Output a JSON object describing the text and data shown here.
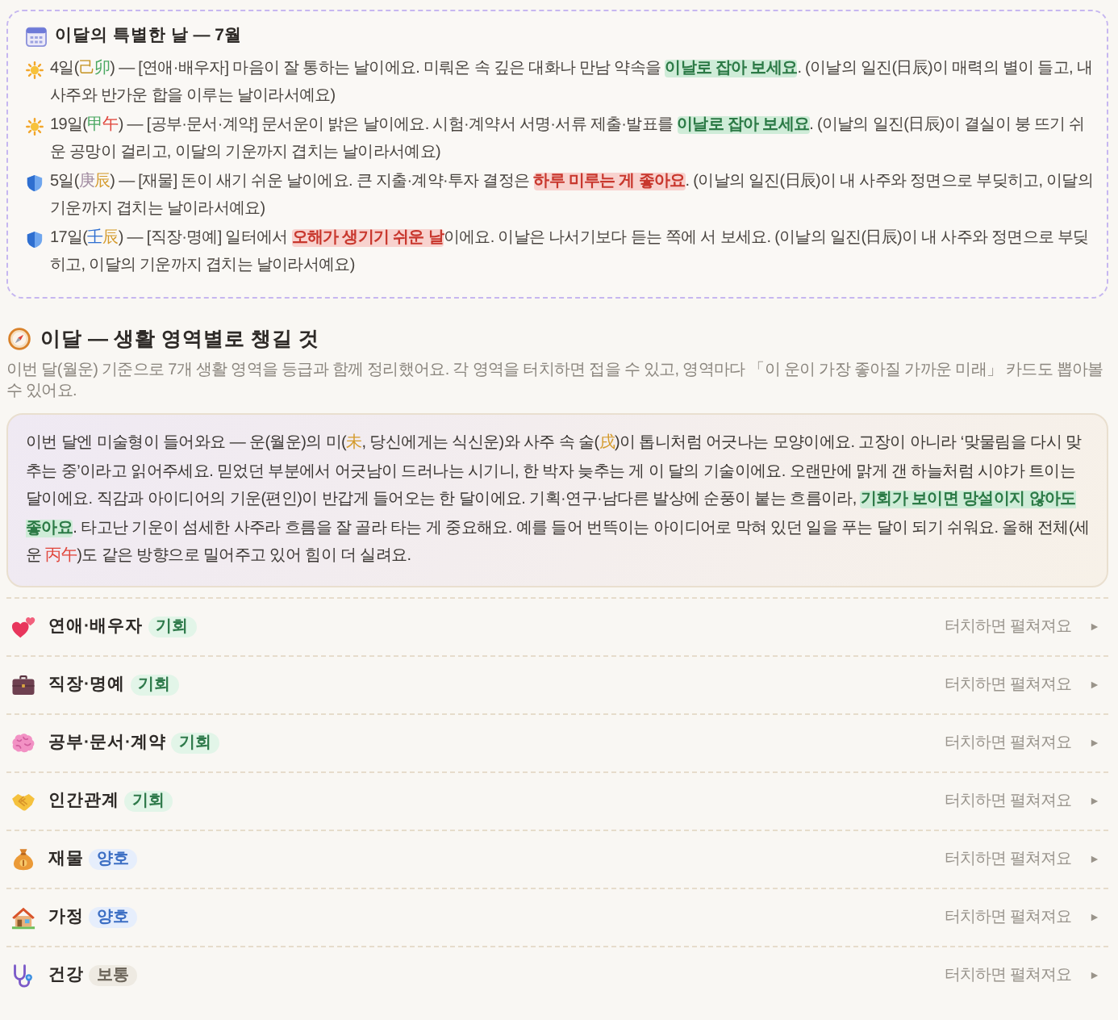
{
  "special_days": {
    "title": "이달의 특별한 날 — 7월",
    "entries": [
      {
        "kind": "good",
        "segments": [
          {
            "kind": "text",
            "text": "4일("
          },
          {
            "kind": "char",
            "text": "己",
            "color": "#c49322"
          },
          {
            "kind": "char",
            "text": "卯",
            "color": "#4aa862"
          },
          {
            "kind": "text",
            "text": ") — [연애·배우자] 마음이 잘 통하는 날이에요. 미뤄온 속 깊은 대화나 만남 약속을 "
          },
          {
            "kind": "good",
            "text": "이날로 잡아 보세요"
          },
          {
            "kind": "text",
            "text": ". (이날의 일진(日辰)이 매력의 별이 들고, 내 사주와 반가운 합을 이루는 날이라서예요)"
          }
        ]
      },
      {
        "kind": "good",
        "segments": [
          {
            "kind": "text",
            "text": "19일("
          },
          {
            "kind": "char",
            "text": "甲",
            "color": "#4aa862"
          },
          {
            "kind": "char",
            "text": "午",
            "color": "#e0443a"
          },
          {
            "kind": "text",
            "text": ") — [공부·문서·계약] 문서운이 밝은 날이에요. 시험·계약서 서명·서류 제출·발표를 "
          },
          {
            "kind": "good",
            "text": "이날로 잡아 보세요"
          },
          {
            "kind": "text",
            "text": ". (이날의 일진(日辰)이 결실이 붕 뜨기 쉬운 공망이 걸리고, 이달의 기운까지 겹치는 날이라서예요)"
          }
        ]
      },
      {
        "kind": "caution",
        "segments": [
          {
            "kind": "text",
            "text": "5일("
          },
          {
            "kind": "char",
            "text": "庚",
            "color": "#a38ea3"
          },
          {
            "kind": "char",
            "text": "辰",
            "color": "#d49a2a"
          },
          {
            "kind": "text",
            "text": ") — [재물] 돈이 새기 쉬운 날이에요. 큰 지출·계약·투자 결정은 "
          },
          {
            "kind": "bad",
            "text": "하루 미루는 게 좋아요"
          },
          {
            "kind": "text",
            "text": ". (이날의 일진(日辰)이 내 사주와 정면으로 부딪히고, 이달의 기운까지 겹치는 날이라서예요)"
          }
        ]
      },
      {
        "kind": "caution",
        "segments": [
          {
            "kind": "text",
            "text": "17일("
          },
          {
            "kind": "char",
            "text": "壬",
            "color": "#2f6fd0"
          },
          {
            "kind": "char",
            "text": "辰",
            "color": "#d49a2a"
          },
          {
            "kind": "text",
            "text": ") — [직장·명예] 일터에서 "
          },
          {
            "kind": "bad",
            "text": "오해가 생기기 쉬운 날"
          },
          {
            "kind": "text",
            "text": "이에요. 이날은 나서기보다 듣는 쪽에 서 보세요. (이날의 일진(日辰)이 내 사주와 정면으로 부딪히고, 이달의 기운까지 겹치는 날이라서예요)"
          }
        ]
      }
    ]
  },
  "areas": {
    "title": "이달 — 생활 영역별로 챙길 것",
    "subtitle": "이번 달(월운) 기준으로 7개 생활 영역을 등급과 함께 정리했어요. 각 영역을 터치하면 접을 수 있고, 영역마다 「이 운이 가장 좋아질 가까운 미래」 카드도 뽑아볼 수 있어요.",
    "summary": {
      "segments": [
        {
          "kind": "text",
          "text": "이번 달엔 미술형이 들어와요 — 운(월운)의 미("
        },
        {
          "kind": "char",
          "text": "未",
          "color": "#d49a2a"
        },
        {
          "kind": "text",
          "text": ", 당신에게는 식신운)와 사주 속 술("
        },
        {
          "kind": "char",
          "text": "戌",
          "color": "#d49a2a"
        },
        {
          "kind": "text",
          "text": ")이 톱니처럼 어긋나는 모양이에요. 고장이 아니라 ‘맞물림을 다시 맞추는 중’이라고 읽어주세요. 믿었던 부분에서 어긋남이 드러나는 시기니, 한 박자 늦추는 게 이 달의 기술이에요. 오랜만에 맑게 갠 하늘처럼 시야가 트이는 달이에요. 직감과 아이디어의 기운(편인)이 반갑게 들어오는 한 달이에요. 기획·연구·남다른 발상에 순풍이 붙는 흐름이라, "
        },
        {
          "kind": "good",
          "text": "기회가 보이면 망설이지 않아도 좋아요"
        },
        {
          "kind": "text",
          "text": ". 타고난 기운이 섬세한 사주라 흐름을 잘 골라 타는 게 중요해요. 예를 들어 번뜩이는 아이디어로 막혀 있던 일을 푸는 달이 되기 쉬워요. 올해 전체(세운 "
        },
        {
          "kind": "char",
          "text": "丙午",
          "color": "#e0443a"
        },
        {
          "kind": "text",
          "text": ")도 같은 방향으로 밀어주고 있어 힘이 더 실려요."
        }
      ]
    },
    "rows": [
      {
        "label": "연애·배우자",
        "badge": {
          "text": "기회",
          "kind": "chance"
        },
        "hint": "터치하면 펼쳐져요",
        "expanded": false
      },
      {
        "label": "직장·명예",
        "badge": {
          "text": "기회",
          "kind": "chance"
        },
        "hint": "터치하면 펼쳐져요",
        "expanded": false
      },
      {
        "label": "공부·문서·계약",
        "badge": {
          "text": "기회",
          "kind": "chance"
        },
        "hint": "터치하면 펼쳐져요",
        "expanded": false
      },
      {
        "label": "인간관계",
        "badge": {
          "text": "기회",
          "kind": "chance"
        },
        "hint": "터치하면 펼쳐져요",
        "expanded": false
      },
      {
        "label": "재물",
        "badge": {
          "text": "양호",
          "kind": "good"
        },
        "hint": "터치하면 펼쳐져요",
        "expanded": false
      },
      {
        "label": "가정",
        "badge": {
          "text": "양호",
          "kind": "good"
        },
        "hint": "터치하면 펼쳐져요",
        "expanded": false
      },
      {
        "label": "건강",
        "badge": {
          "text": "보통",
          "kind": "normal"
        },
        "hint": "터치하면 펼쳐져요",
        "expanded": false
      }
    ]
  }
}
